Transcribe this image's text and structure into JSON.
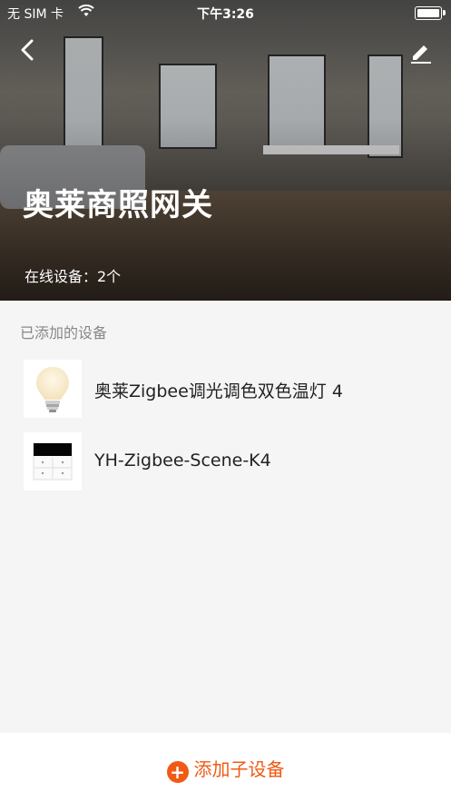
{
  "status_bar": {
    "carrier": "无 SIM 卡",
    "time": "下午3:26"
  },
  "header": {
    "gateway_name": "奥莱商照网关",
    "online_text": "在线设备：2个"
  },
  "section": {
    "label": "已添加的设备"
  },
  "devices": [
    {
      "name": "奥莱Zigbee调光调色双色温灯 4",
      "icon": "bulb-icon"
    },
    {
      "name": "YH-Zigbee-Scene-K4",
      "icon": "scene-switch-icon"
    }
  ],
  "actions": {
    "add_label": "添加子设备"
  },
  "colors": {
    "accent": "#f05a14"
  }
}
